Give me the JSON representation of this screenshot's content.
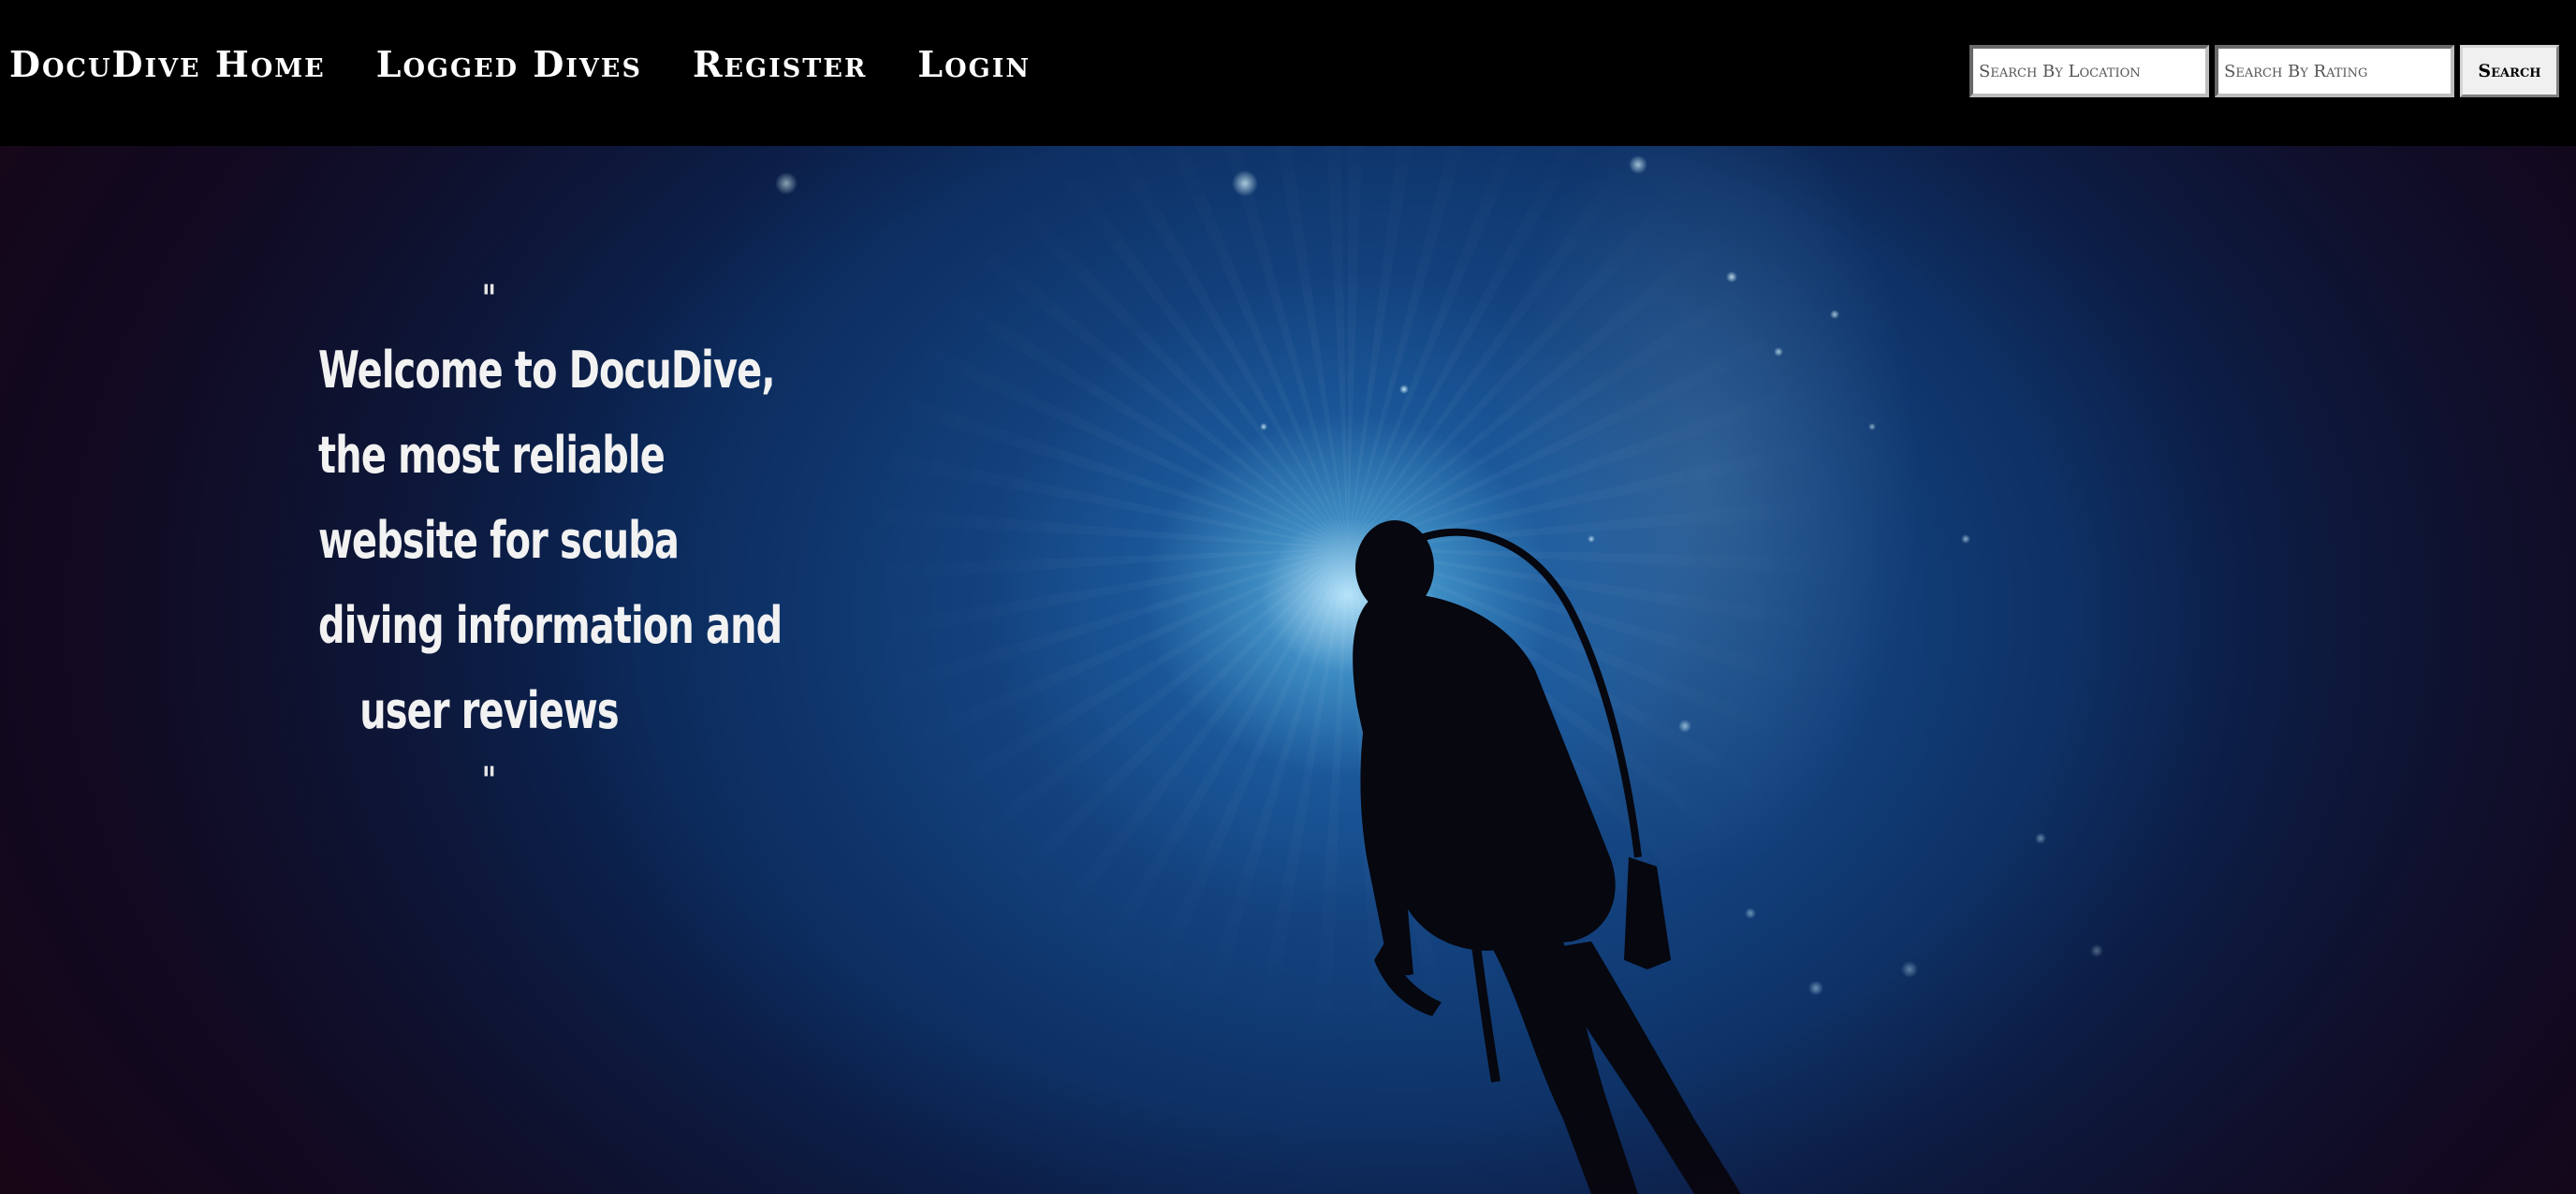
{
  "nav": {
    "links": [
      {
        "label": "DocuDive Home"
      },
      {
        "label": "Logged Dives"
      },
      {
        "label": "Register"
      },
      {
        "label": "Login"
      }
    ]
  },
  "search": {
    "location_placeholder": "Search By Location",
    "rating_placeholder": "Search By Rating",
    "button_label": "Search"
  },
  "hero": {
    "open_quote": "\"",
    "lines": [
      "Welcome to DocuDive,",
      "the most reliable",
      "website for scuba",
      "diving information and",
      "user reviews"
    ],
    "close_quote": "\""
  },
  "colors": {
    "navbar_bg": "#000000",
    "nav_text": "#ffffff",
    "hero_text": "#f2f2f2",
    "ocean_deep": "#0a2452",
    "ocean_light": "#1d5a9c"
  }
}
